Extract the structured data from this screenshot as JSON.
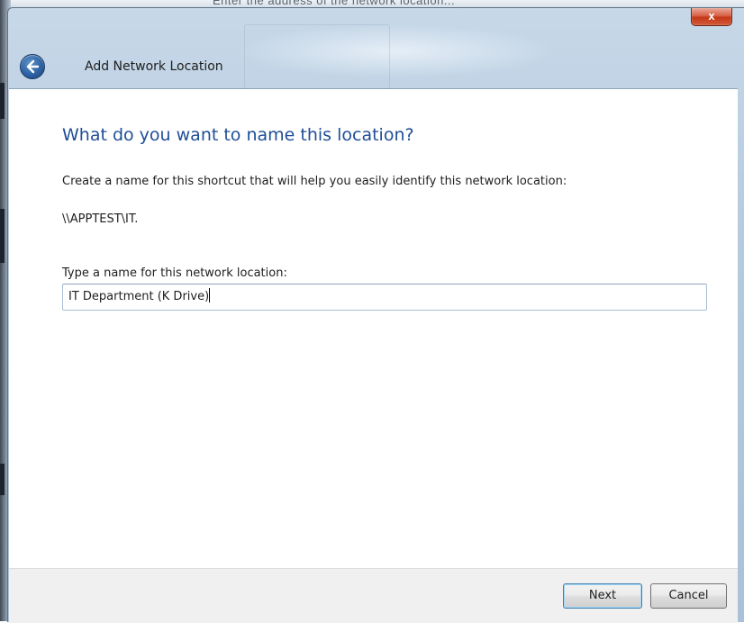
{
  "background": {
    "partial_text": "Enter the address of the network location..."
  },
  "window": {
    "title": "Add Network Location",
    "close_label": "x"
  },
  "content": {
    "heading": "What do you want to name this location?",
    "instruction": "Create a name for this shortcut that will help you easily identify this network location:",
    "network_path": "\\\\APPTEST\\IT.",
    "field_label": "Type a name for this network location:",
    "name_value": "IT Department (K Drive)"
  },
  "footer": {
    "next_label": "Next",
    "cancel_label": "Cancel"
  },
  "colors": {
    "heading": "#1f4e97",
    "frame": "#b4cadf",
    "footer": "#f0f0f0"
  },
  "icons": {
    "back": "back-arrow-icon",
    "close": "close-icon"
  }
}
